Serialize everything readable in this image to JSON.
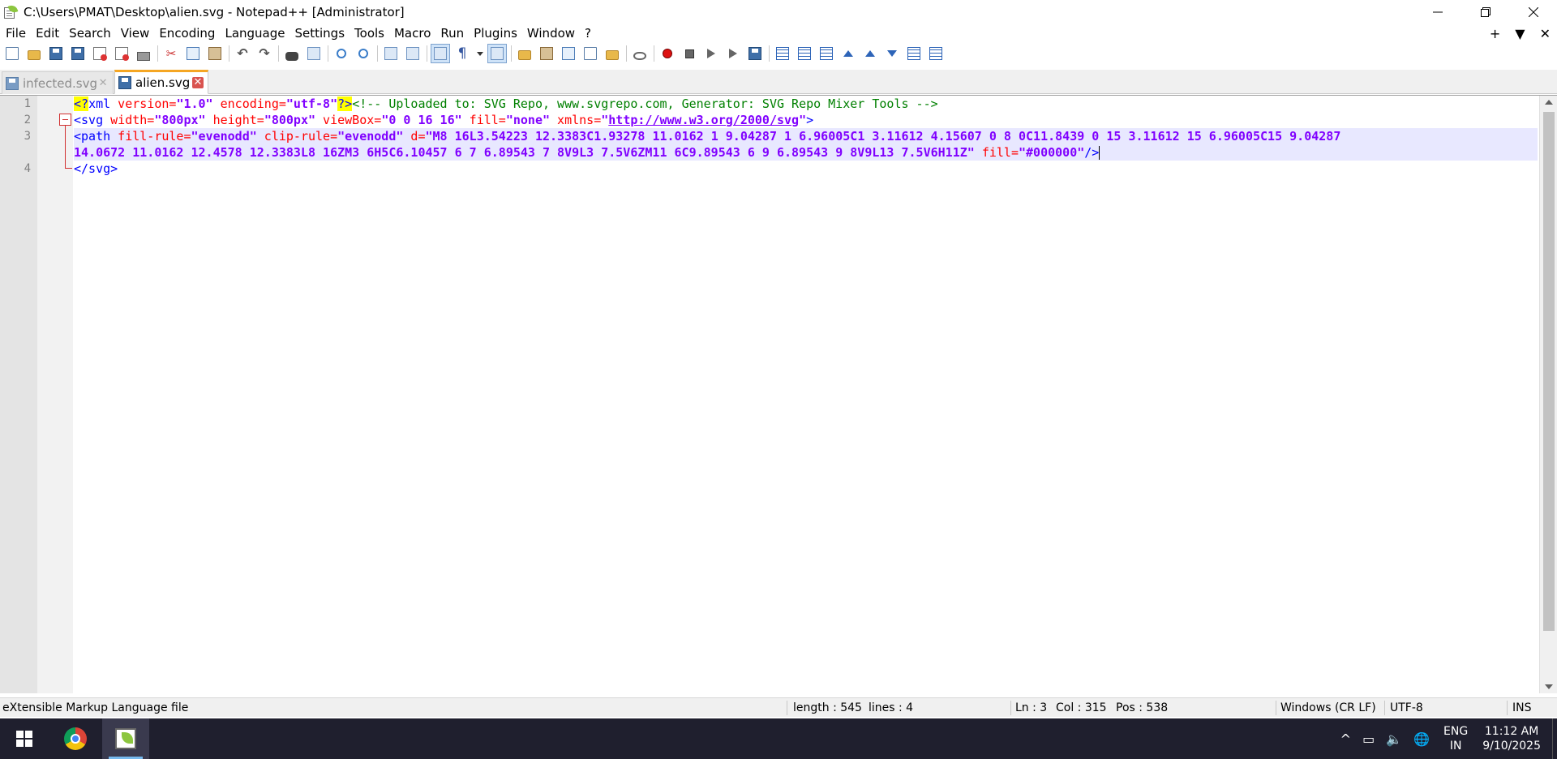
{
  "window": {
    "title": "C:\\Users\\PMAT\\Desktop\\alien.svg - Notepad++ [Administrator]",
    "minimize_glyph": "—",
    "maximize_glyph": "❐",
    "close_glyph": "✕"
  },
  "menu": {
    "items": [
      "File",
      "Edit",
      "Search",
      "View",
      "Encoding",
      "Language",
      "Settings",
      "Tools",
      "Macro",
      "Run",
      "Plugins",
      "Window",
      "?"
    ],
    "right": {
      "plus": "+",
      "down": "▼",
      "close": "✕"
    }
  },
  "tabs": [
    {
      "label": "infected.svg",
      "active": false
    },
    {
      "label": "alien.svg",
      "active": true
    }
  ],
  "editor": {
    "line_numbers": [
      "1",
      "2",
      "3",
      "4"
    ],
    "line1": {
      "pi_open": "<?",
      "pi_name": "xml",
      "a1": " version=",
      "v1": "\"1.0\"",
      "a2": " encoding=",
      "v2": "\"utf-8\"",
      "pi_close": "?>",
      "comment": "<!-- Uploaded to: SVG Repo, www.svgrepo.com, Generator: SVG Repo Mixer Tools -->"
    },
    "line2": {
      "tag": "<svg",
      "a1": " width=",
      "v1": "\"800px\"",
      "a2": " height=",
      "v2": "\"800px\"",
      "a3": " viewBox=",
      "v3": "\"0 0 16 16\"",
      "a4": " fill=",
      "v4": "\"none\"",
      "a5": " xmlns=",
      "q_open": "\"",
      "url": "http://www.w3.org/2000/svg",
      "q_close": "\"",
      "end": ">"
    },
    "line3": {
      "tag": "<path",
      "a1": " fill-rule=",
      "v1": "\"evenodd\"",
      "a2": " clip-rule=",
      "v2": "\"evenodd\"",
      "a3": " d=",
      "v3a": "\"M8 16L3.54223 12.3383C1.93278 11.0162 1 9.04287 1 6.96005C1 3.11612 4.15607 0 8 0C11.8439 0 15 3.11612 15 6.96005C15 9.04287",
      "v3b": "14.0672 11.0162 12.4578 12.3383L8 16ZM3 6H5C6.10457 6 7 6.89543 7 8V9L3 7.5V6ZM11 6C9.89543 6 9 6.89543 9 8V9L13 7.5V6H11Z\"",
      "a4": " fill=",
      "v4": "\"#000000\"",
      "end": "/>"
    },
    "line4": {
      "tag": "</svg>"
    }
  },
  "status": {
    "filetype": "eXtensible Markup Language file",
    "length": "length : 545",
    "lines": "lines : 4",
    "ln": "Ln : 3",
    "col": "Col : 315",
    "pos": "Pos : 538",
    "eol": "Windows (CR LF)",
    "encoding": "UTF-8",
    "mode": "INS"
  },
  "taskbar": {
    "lang_top": "ENG",
    "lang_bottom": "IN",
    "time": "11:12 AM",
    "date": "9/10/2025",
    "chevron": "^"
  },
  "colors": {
    "tag": "#0000ff",
    "attribute": "#ff0000",
    "value": "#8000ff",
    "comment": "#008000",
    "current_line": "#e8e8ff",
    "active_tab_accent": "#f5a623"
  }
}
